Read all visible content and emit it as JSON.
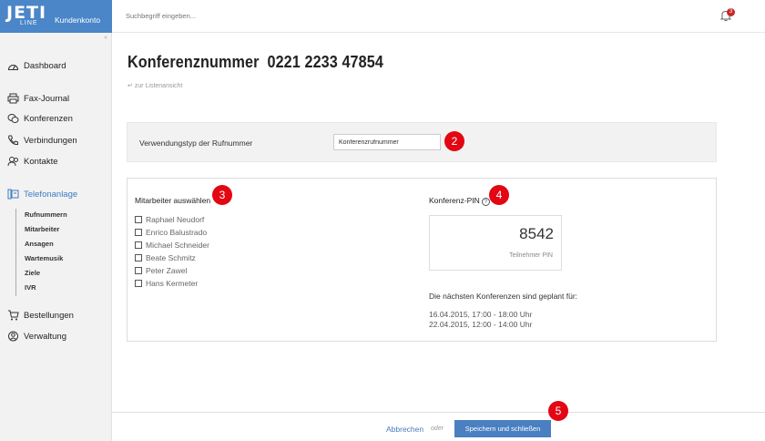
{
  "brand": {
    "logo_main": "JETI",
    "logo_sub": "LINE",
    "account_label": "Kundenkonto"
  },
  "search": {
    "placeholder": "Suchbegriff eingeben..."
  },
  "notifications": {
    "count": "3"
  },
  "sidebar": {
    "collapse": "«",
    "items": [
      {
        "label": "Dashboard",
        "icon": "dashboard-icon"
      },
      {
        "label": "Fax-Journal",
        "icon": "printer-icon"
      },
      {
        "label": "Konferenzen",
        "icon": "conference-icon"
      },
      {
        "label": "Verbindungen",
        "icon": "phone-icon"
      },
      {
        "label": "Kontakte",
        "icon": "contacts-icon"
      },
      {
        "label": "Telefonanlage",
        "icon": "pbx-icon"
      },
      {
        "label": "Bestellungen",
        "icon": "cart-icon"
      },
      {
        "label": "Verwaltung",
        "icon": "admin-icon"
      }
    ],
    "subitems": [
      "Rufnummern",
      "Mitarbeiter",
      "Ansagen",
      "Wartemusik",
      "Ziele",
      "IVR"
    ]
  },
  "page": {
    "title_label": "Konferenznummer",
    "title_number": "0221 2233 47854",
    "back_link": "zur Listenansicht"
  },
  "usage": {
    "label": "Verwendungstyp der Rufnummer",
    "value": "Konferenzrufnummer"
  },
  "employees": {
    "title": "Mitarbeiter auswählen",
    "list": [
      "Raphael Neudorf",
      "Enrico Balustrado",
      "Michael Schneider",
      "Beate Schmitz",
      "Peter Zawel",
      "Hans Kermeter"
    ]
  },
  "pin": {
    "title": "Konferenz-PIN",
    "help": "?",
    "value": "8542",
    "label": "Teilnehmer PIN"
  },
  "schedule": {
    "title": "Die nächsten Konferenzen sind geplant für:",
    "entries": [
      "16.04.2015, 17:00 - 18:00 Uhr",
      "22.04.2015, 12:00 - 14:00 Uhr"
    ]
  },
  "footer": {
    "cancel": "Abbrechen",
    "or": "oder",
    "save": "Speichern und schließen"
  },
  "markers": [
    "2",
    "3",
    "4",
    "5"
  ],
  "colors": {
    "brand": "#4a86c8",
    "accent": "#3a7cc2",
    "marker": "#e30613",
    "button": "#4a7fc1"
  }
}
